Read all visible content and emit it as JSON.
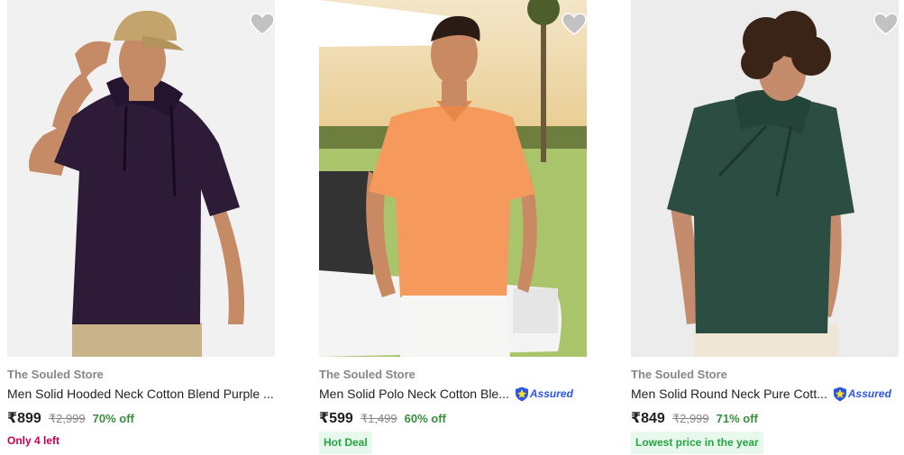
{
  "products": [
    {
      "brand": "The Souled Store",
      "title": "Men Solid Hooded Neck Cotton Blend Purple ...",
      "price": "₹899",
      "mrp": "₹2,999",
      "discount": "70% off",
      "stock_note": "Only 4 left",
      "assured": false,
      "tag": "",
      "shirt_color": "#2e1b38",
      "bg_color": "#f1f1f1"
    },
    {
      "brand": "The Souled Store",
      "title": "Men Solid Polo Neck Cotton Ble...",
      "price": "₹599",
      "mrp": "₹1,499",
      "discount": "60% off",
      "stock_note": "",
      "assured": true,
      "assured_label": "Assured",
      "tag": "Hot Deal",
      "shirt_color": "#f59a5c",
      "bg_color": "#bcd08a"
    },
    {
      "brand": "The Souled Store",
      "title": "Men Solid Round Neck Pure Cott...",
      "price": "₹849",
      "mrp": "₹2,999",
      "discount": "71% off",
      "stock_note": "",
      "assured": true,
      "assured_label": "Assured",
      "tag": "Lowest price in the year",
      "shirt_color": "#2c4d42",
      "bg_color": "#ececec"
    }
  ],
  "colors": {
    "brand_text": "#878787",
    "discount_green": "#388e3c",
    "stock_pink": "#c70055",
    "tag_bg": "#e7f8ec",
    "tag_text": "#26a541",
    "assured_blue": "#2a55e5",
    "wishlist_heart": "#c2c2c2"
  },
  "icons": [
    "heart-icon",
    "assured-badge-icon"
  ]
}
